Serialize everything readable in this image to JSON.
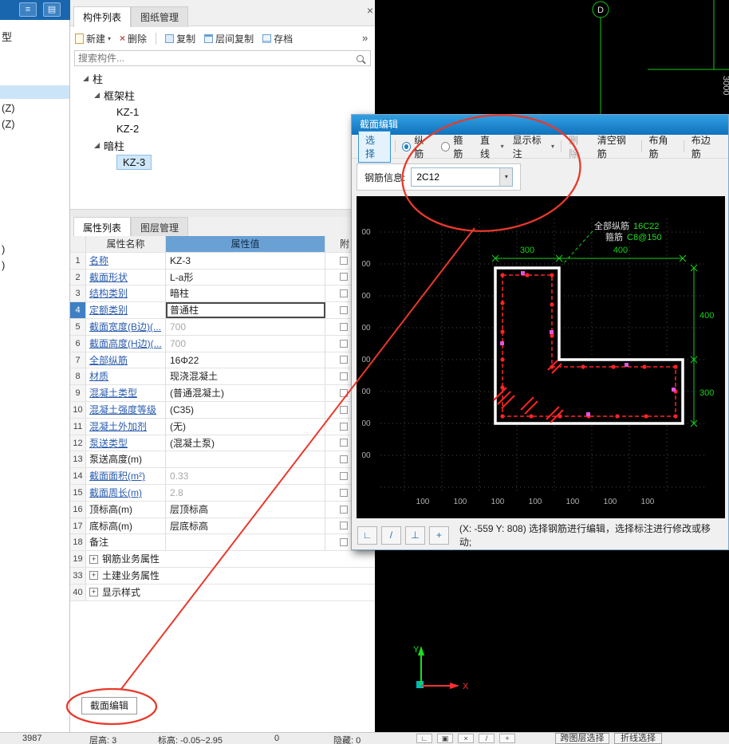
{
  "glyphs": {
    "list": "≡",
    "panel": "▤",
    "caret": "▾",
    "overflow": "»",
    "close": "×",
    "cross": "×",
    "plus": "+",
    "angle": "∟",
    "slash": "/",
    "flip": "⊥",
    "box": "▣"
  },
  "left_strip": {
    "top": "型",
    "z1": "(Z)",
    "z2": "(Z)",
    "p1": ")",
    "p2": ")"
  },
  "component_panel": {
    "tab_components": "构件列表",
    "tab_drawings": "图纸管理",
    "toolbar": {
      "new": "新建",
      "del": "删除",
      "copy": "复制",
      "floor_copy": "层间复制",
      "archive": "存档"
    },
    "search_placeholder": "搜索构件...",
    "tree": [
      {
        "label": "柱"
      },
      {
        "label": "框架柱"
      },
      {
        "label": "KZ-1"
      },
      {
        "label": "KZ-2"
      },
      {
        "label": "暗柱"
      },
      {
        "label": "KZ-3"
      }
    ]
  },
  "property_panel": {
    "tab_props": "属性列表",
    "tab_layers": "图层管理",
    "col_name": "属性名称",
    "col_value": "属性值",
    "col_attach": "附",
    "rows": [
      {
        "no": "1",
        "name": "名称",
        "value": "KZ-3"
      },
      {
        "no": "2",
        "name": "截面形状",
        "value": "L-a形"
      },
      {
        "no": "3",
        "name": "结构类别",
        "value": "暗柱"
      },
      {
        "no": "4",
        "name": "定额类别",
        "value": "普通柱"
      },
      {
        "no": "5",
        "name": "截面宽度(B边)(...",
        "value": "700"
      },
      {
        "no": "6",
        "name": "截面高度(H边)(...",
        "value": "700"
      },
      {
        "no": "7",
        "name": "全部纵筋",
        "value": "16Φ22"
      },
      {
        "no": "8",
        "name": "材质",
        "value": "现浇混凝土"
      },
      {
        "no": "9",
        "name": "混凝土类型",
        "value": "(普通混凝土)"
      },
      {
        "no": "10",
        "name": "混凝土强度等级",
        "value": "(C35)"
      },
      {
        "no": "11",
        "name": "混凝土外加剂",
        "value": "(无)"
      },
      {
        "no": "12",
        "name": "泵送类型",
        "value": "(混凝土泵)"
      },
      {
        "no": "13",
        "name": "泵送高度(m)",
        "value": ""
      },
      {
        "no": "14",
        "name": "截面面积(m²)",
        "value": "0.33"
      },
      {
        "no": "15",
        "name": "截面周长(m)",
        "value": "2.8"
      },
      {
        "no": "16",
        "name": "顶标高(m)",
        "value": "层顶标高"
      },
      {
        "no": "17",
        "name": "底标高(m)",
        "value": "层底标高"
      },
      {
        "no": "18",
        "name": "备注",
        "value": ""
      },
      {
        "no": "19",
        "name": "钢筋业务属性"
      },
      {
        "no": "33",
        "name": "土建业务属性"
      },
      {
        "no": "40",
        "name": "显示样式"
      }
    ],
    "section_edit": "截面编辑"
  },
  "dialog": {
    "title": "截面编辑",
    "toolbar": {
      "select": "选择",
      "longitudinal": "纵筋",
      "stirrup": "箍筋",
      "line": "直线",
      "show_label": "显示标注",
      "del": "删除",
      "clear": "清空钢筋",
      "corner_bar": "布角筋",
      "edge_bar": "布边筋"
    },
    "info_label": "钢筋信息:",
    "info_value": "2C12",
    "status": "(X: -559 Y: 808) 选择钢筋进行编辑，选择标注进行修改或移动;",
    "canvas": {
      "dim_300_top": "300",
      "dim_400_top": "400",
      "dim_400_right": "400",
      "dim_300_right": "300",
      "grid_label": "100",
      "grid_label_left": "00",
      "note1_label": "全部纵筋",
      "note1_value": "16C22",
      "note2_label": "箍筋",
      "note2_value": "C8@150"
    }
  },
  "viewport": {
    "axis_bubble": "D",
    "dim": "3000",
    "ucs_x": "X",
    "ucs_y": "Y"
  },
  "statusbar": {
    "count": "3987",
    "floor": "层高: 3",
    "elevation": "标高: -0.05~2.95",
    "zero": "0",
    "hidden": "隐藏: 0",
    "cross_layer": "跨图层选择",
    "polyline": "折线选择"
  }
}
